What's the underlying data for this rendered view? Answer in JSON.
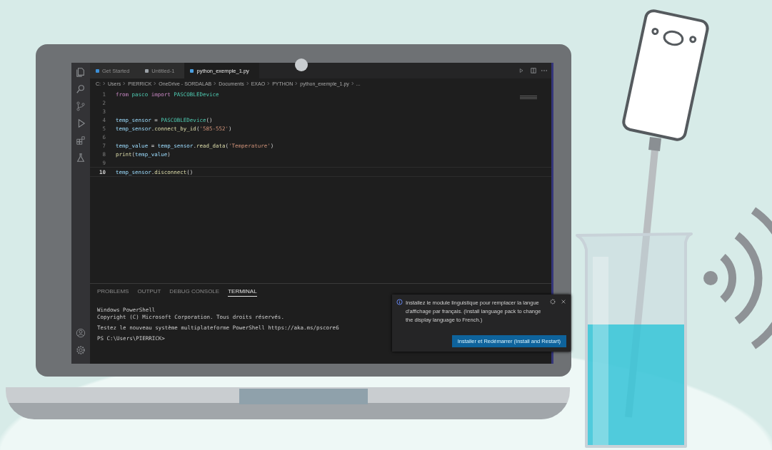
{
  "editor": {
    "tabs": [
      {
        "label": "Get Started",
        "kind": "welcome",
        "selected": false
      },
      {
        "label": "Untitled-1",
        "kind": "text",
        "selected": false
      },
      {
        "label": "python_exemple_1.py",
        "kind": "python",
        "selected": true
      }
    ],
    "breadcrumb": [
      "C:",
      "Users",
      "PIERRICK",
      "OneDrive - SORDALAB",
      "Documents",
      "EXAO",
      "PYTHON",
      "python_exemple_1.py",
      "..."
    ],
    "code": [
      {
        "number": "1",
        "current": false,
        "tokens": [
          {
            "text": "from ",
            "kind": "keyword"
          },
          {
            "text": "pasco ",
            "kind": "class"
          },
          {
            "text": "import ",
            "kind": "keyword"
          },
          {
            "text": "PASCOBLEDevice",
            "kind": "class"
          }
        ]
      },
      {
        "number": "2",
        "current": false
      },
      {
        "number": "3",
        "current": false
      },
      {
        "number": "4",
        "current": false,
        "tokens": [
          {
            "text": "temp_sensor",
            "kind": "variable"
          },
          {
            "text": " = ",
            "kind": "plain"
          },
          {
            "text": "PASCOBLEDevice",
            "kind": "class"
          },
          {
            "text": "()",
            "kind": "plain"
          }
        ]
      },
      {
        "number": "5",
        "current": false,
        "tokens": [
          {
            "text": "temp_sensor",
            "kind": "variable"
          },
          {
            "text": ".",
            "kind": "plain"
          },
          {
            "text": "connect_by_id",
            "kind": "function"
          },
          {
            "text": "(",
            "kind": "plain"
          },
          {
            "text": "'585-552'",
            "kind": "string"
          },
          {
            "text": ")",
            "kind": "plain"
          }
        ]
      },
      {
        "number": "6",
        "current": false
      },
      {
        "number": "7",
        "current": false,
        "tokens": [
          {
            "text": "temp_value",
            "kind": "variable"
          },
          {
            "text": " = ",
            "kind": "plain"
          },
          {
            "text": "temp_sensor",
            "kind": "variable"
          },
          {
            "text": ".",
            "kind": "plain"
          },
          {
            "text": "read_data",
            "kind": "function"
          },
          {
            "text": "(",
            "kind": "plain"
          },
          {
            "text": "'Temperature'",
            "kind": "string"
          },
          {
            "text": ")",
            "kind": "plain"
          }
        ]
      },
      {
        "number": "8",
        "current": false,
        "tokens": [
          {
            "text": "print",
            "kind": "function"
          },
          {
            "text": "(",
            "kind": "plain"
          },
          {
            "text": "temp_value",
            "kind": "variable"
          },
          {
            "text": ")",
            "kind": "plain"
          }
        ]
      },
      {
        "number": "9",
        "current": false
      },
      {
        "number": "10",
        "current": true,
        "tokens": [
          {
            "text": "temp_sensor",
            "kind": "variable"
          },
          {
            "text": ".",
            "kind": "plain"
          },
          {
            "text": "disconnect",
            "kind": "function"
          },
          {
            "text": "()",
            "kind": "plain"
          }
        ]
      }
    ]
  },
  "panel": {
    "tabs": [
      {
        "label": "PROBLEMS",
        "selected": false
      },
      {
        "label": "OUTPUT",
        "selected": false
      },
      {
        "label": "DEBUG CONSOLE",
        "selected": false
      },
      {
        "label": "TERMINAL",
        "selected": true
      }
    ],
    "terminal": [
      [
        "Windows PowerShell",
        "Copyright (C) Microsoft Corporation. Tous droits réservés."
      ],
      [
        "Testez le nouveau système multiplateforme PowerShell https://aka.ms/pscore6"
      ],
      [
        "PS C:\\Users\\PIERRICK>"
      ]
    ]
  },
  "notification": {
    "message": "Installez le module linguistique pour remplacer la langue d'affichage par français. (Install language pack to change the display language to French.)",
    "button": "Installer et Redémarrer (Install and Restart)"
  }
}
